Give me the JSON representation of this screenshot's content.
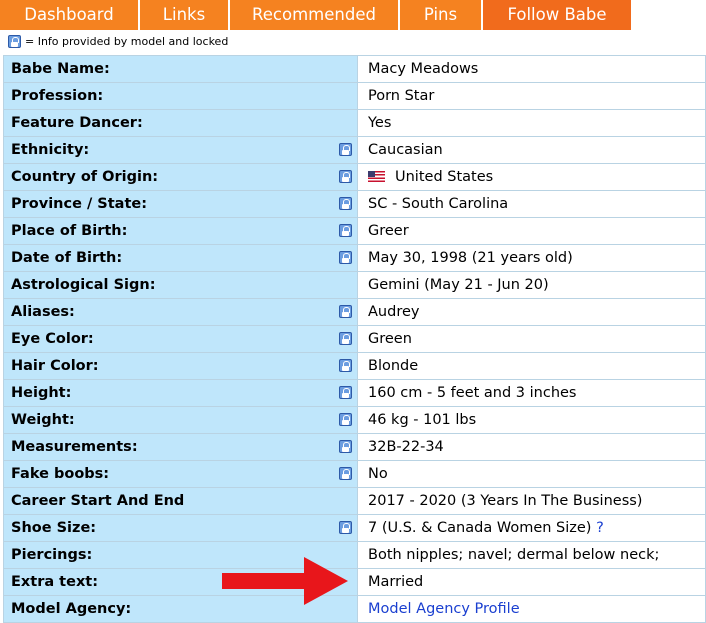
{
  "tabs": [
    {
      "label": "Dashboard"
    },
    {
      "label": "Links"
    },
    {
      "label": "Recommended"
    },
    {
      "label": "Pins"
    },
    {
      "label": "Follow Babe"
    }
  ],
  "legend": {
    "text": "= Info provided by model and locked",
    "icon": "lock-icon"
  },
  "rows": [
    {
      "label": "Babe Name:",
      "value": "Macy Meadows",
      "locked": false
    },
    {
      "label": "Profession:",
      "value": "Porn Star",
      "locked": false
    },
    {
      "label": "Feature Dancer:",
      "value": "Yes",
      "locked": false
    },
    {
      "label": "Ethnicity:",
      "value": "Caucasian",
      "locked": true
    },
    {
      "label": "Country of Origin:",
      "value": "United States",
      "locked": true,
      "icon": "us-flag-icon"
    },
    {
      "label": "Province / State:",
      "value": "SC - South Carolina",
      "locked": true
    },
    {
      "label": "Place of Birth:",
      "value": "Greer",
      "locked": true
    },
    {
      "label": "Date of Birth:",
      "value": "May 30, 1998 (21 years old)",
      "locked": true
    },
    {
      "label": "Astrological Sign:",
      "value": "Gemini (May 21 - Jun 20)",
      "locked": false
    },
    {
      "label": "Aliases:",
      "value": "Audrey",
      "locked": true
    },
    {
      "label": "Eye Color:",
      "value": "Green",
      "locked": true
    },
    {
      "label": "Hair Color:",
      "value": "Blonde",
      "locked": true
    },
    {
      "label": "Height:",
      "value": "160 cm - 5 feet and 3 inches",
      "locked": true
    },
    {
      "label": "Weight:",
      "value": "46 kg - 101 lbs",
      "locked": true
    },
    {
      "label": "Measurements:",
      "value": "32B-22-34",
      "locked": true
    },
    {
      "label": "Fake boobs:",
      "value": "No",
      "locked": true
    },
    {
      "label": "Career Start And End",
      "value": "2017 - 2020 (3 Years In The Business)",
      "locked": false
    },
    {
      "label": "Shoe Size:",
      "value": "7 (U.S. & Canada Women Size)",
      "help": "?",
      "locked": true
    },
    {
      "label": "Piercings:",
      "value": "Both nipples; navel; dermal below neck;",
      "locked": false
    },
    {
      "label": "Extra text:",
      "value": "Married",
      "locked": false
    },
    {
      "label": "Model Agency:",
      "value": "Model Agency Profile",
      "locked": false
    }
  ],
  "colors": {
    "tab_bg": "#f58220",
    "tab_active_bg": "#f16b1c",
    "label_bg": "#bfe6fb",
    "name_color": "#8b1a8f",
    "link_color": "#1a3fd0",
    "arrow_color": "#e8161b"
  },
  "annotation": {
    "icon": "red-arrow-icon"
  }
}
